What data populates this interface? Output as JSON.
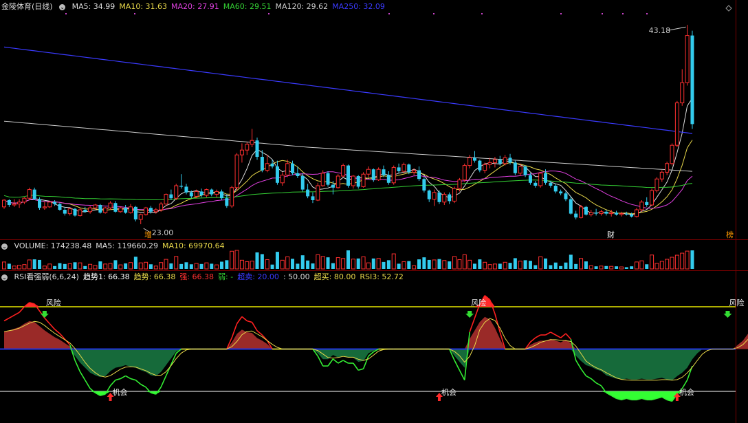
{
  "price_panel": {
    "title": "金陵体育(日线)",
    "ma_items": [
      {
        "label": "MA5: 34.99",
        "color": "#dddddd"
      },
      {
        "label": "MA10: 31.63",
        "color": "#e8d84a"
      },
      {
        "label": "MA20: 27.91",
        "color": "#e040e0"
      },
      {
        "label": "MA60: 29.51",
        "color": "#34d134"
      },
      {
        "label": "MA120: 29.62",
        "color": "#cccccc"
      },
      {
        "label": "MA250: 32.09",
        "color": "#3a3aff"
      }
    ],
    "high_label": "43.18",
    "low_label": "23.00",
    "markers": [
      {
        "text": "增",
        "color": "#ff9900"
      },
      {
        "text": "财",
        "color": "#ffffff"
      },
      {
        "text": "榜",
        "color": "#ff9900"
      }
    ]
  },
  "volume_panel": {
    "items": [
      {
        "label": "VOLUME: 174238.48",
        "color": "#dddddd"
      },
      {
        "label": "MA5: 119660.29",
        "color": "#dddddd"
      },
      {
        "label": "MA10: 69970.64",
        "color": "#e8d84a"
      }
    ]
  },
  "rsi_panel": {
    "items": [
      {
        "label": "RSI看强弱(6,6,24)",
        "color": "#dddddd"
      },
      {
        "label": "趋势1: 66.38",
        "color": "#ffffff"
      },
      {
        "label": "趋势: 66.38",
        "color": "#e8d84a"
      },
      {
        "label": "强: 66.38",
        "color": "#ff3030"
      },
      {
        "label": "弱: -",
        "color": "#34d134"
      },
      {
        "label": "超卖: 20.00",
        "color": "#3a3aff"
      },
      {
        "label": ": 50.00",
        "color": "#dddddd"
      },
      {
        "label": "超买: 80.00",
        "color": "#e8d84a"
      },
      {
        "label": "RSI3: 52.72",
        "color": "#e8d84a"
      }
    ],
    "signals": [
      {
        "text": "风险",
        "kind": "risk"
      },
      {
        "text": "风险",
        "kind": "risk"
      },
      {
        "text": "风险",
        "kind": "risk"
      },
      {
        "text": "机会",
        "kind": "chance"
      },
      {
        "text": "机会",
        "kind": "chance"
      },
      {
        "text": "机会",
        "kind": "chance"
      }
    ]
  },
  "chart_data": {
    "type": "candlestick",
    "title": "金陵体育(日线)",
    "ylim": [
      21.5,
      44.5
    ],
    "candles": [
      [
        24.3,
        25.1,
        24.1,
        25.0
      ],
      [
        25.0,
        25.1,
        24.3,
        24.5
      ],
      [
        24.5,
        25.1,
        24.3,
        24.6
      ],
      [
        24.6,
        25.1,
        24.2,
        24.8
      ],
      [
        24.8,
        25.3,
        24.6,
        25.2
      ],
      [
        25.2,
        26.3,
        25.0,
        26.1
      ],
      [
        26.1,
        26.3,
        25.0,
        25.1
      ],
      [
        25.1,
        25.3,
        24.0,
        24.2
      ],
      [
        24.2,
        24.8,
        24.0,
        24.3
      ],
      [
        24.3,
        24.9,
        24.2,
        24.8
      ],
      [
        24.8,
        25.0,
        24.4,
        24.6
      ],
      [
        24.6,
        24.7,
        23.9,
        24.0
      ],
      [
        24.0,
        24.3,
        23.4,
        23.6
      ],
      [
        23.6,
        24.2,
        23.4,
        24.1
      ],
      [
        24.1,
        24.2,
        23.3,
        23.4
      ],
      [
        23.4,
        24.2,
        23.3,
        24.0
      ],
      [
        24.0,
        24.3,
        23.7,
        23.8
      ],
      [
        23.8,
        24.4,
        23.6,
        24.2
      ],
      [
        24.2,
        24.6,
        24.0,
        24.5
      ],
      [
        24.5,
        24.6,
        23.6,
        23.7
      ],
      [
        23.7,
        24.3,
        23.6,
        24.2
      ],
      [
        24.2,
        24.9,
        24.0,
        24.7
      ],
      [
        24.7,
        24.9,
        23.7,
        23.8
      ],
      [
        23.8,
        24.3,
        23.7,
        24.2
      ],
      [
        24.2,
        24.5,
        23.6,
        23.7
      ],
      [
        23.7,
        24.6,
        23.6,
        24.3
      ],
      [
        24.3,
        24.4,
        22.8,
        23.0
      ],
      [
        23.0,
        23.6,
        22.5,
        23.5
      ],
      [
        23.5,
        24.3,
        23.4,
        24.2
      ],
      [
        24.2,
        24.4,
        23.6,
        23.8
      ],
      [
        23.8,
        24.2,
        23.6,
        24.0
      ],
      [
        24.0,
        24.8,
        23.8,
        24.6
      ],
      [
        24.6,
        25.7,
        24.4,
        25.6
      ],
      [
        25.6,
        26.1,
        25.0,
        25.2
      ],
      [
        25.2,
        26.7,
        25.0,
        26.5
      ],
      [
        26.5,
        27.7,
        26.2,
        26.4
      ],
      [
        26.4,
        26.7,
        25.6,
        25.8
      ],
      [
        25.8,
        26.0,
        25.2,
        25.4
      ],
      [
        25.4,
        26.1,
        25.2,
        25.9
      ],
      [
        25.9,
        26.2,
        25.3,
        25.5
      ],
      [
        25.5,
        26.2,
        25.3,
        26.1
      ],
      [
        26.1,
        26.2,
        25.4,
        25.6
      ],
      [
        25.6,
        26.1,
        25.3,
        25.9
      ],
      [
        25.9,
        26.1,
        25.0,
        25.2
      ],
      [
        25.2,
        25.6,
        24.2,
        24.4
      ],
      [
        24.4,
        26.5,
        24.2,
        26.3
      ],
      [
        26.3,
        29.9,
        26.0,
        29.7
      ],
      [
        29.7,
        30.9,
        28.9,
        30.2
      ],
      [
        30.2,
        31.0,
        29.7,
        30.8
      ],
      [
        30.8,
        32.4,
        30.5,
        31.2
      ],
      [
        31.2,
        31.5,
        29.2,
        29.5
      ],
      [
        29.5,
        30.2,
        27.9,
        28.1
      ],
      [
        28.1,
        29.7,
        27.9,
        28.8
      ],
      [
        28.8,
        29.2,
        28.3,
        28.5
      ],
      [
        28.5,
        29.1,
        26.6,
        26.8
      ],
      [
        26.8,
        27.9,
        26.5,
        27.6
      ],
      [
        27.6,
        29.2,
        27.4,
        28.8
      ],
      [
        28.8,
        29.1,
        27.6,
        27.8
      ],
      [
        27.8,
        28.5,
        27.3,
        27.5
      ],
      [
        27.5,
        27.8,
        25.9,
        26.1
      ],
      [
        26.1,
        26.7,
        25.2,
        25.4
      ],
      [
        25.4,
        25.8,
        24.7,
        25.0
      ],
      [
        25.0,
        26.8,
        24.9,
        26.5
      ],
      [
        26.5,
        28.1,
        26.4,
        27.8
      ],
      [
        27.8,
        28.0,
        26.4,
        26.6
      ],
      [
        26.6,
        27.0,
        25.6,
        26.3
      ],
      [
        26.3,
        27.7,
        26.2,
        27.5
      ],
      [
        27.5,
        28.8,
        27.4,
        28.6
      ],
      [
        28.6,
        28.7,
        26.3,
        26.5
      ],
      [
        26.5,
        27.6,
        26.2,
        27.5
      ],
      [
        27.5,
        27.6,
        26.2,
        26.4
      ],
      [
        26.4,
        27.9,
        26.3,
        27.7
      ],
      [
        27.7,
        28.5,
        27.4,
        28.2
      ],
      [
        28.2,
        28.3,
        26.9,
        27.1
      ],
      [
        27.1,
        28.4,
        27.0,
        28.2
      ],
      [
        28.2,
        28.6,
        27.4,
        27.6
      ],
      [
        27.6,
        28.0,
        26.6,
        26.8
      ],
      [
        26.8,
        28.6,
        26.6,
        28.4
      ],
      [
        28.4,
        28.8,
        27.8,
        28.0
      ],
      [
        28.0,
        28.9,
        27.8,
        28.7
      ],
      [
        28.7,
        28.8,
        27.7,
        27.9
      ],
      [
        27.9,
        28.3,
        27.6,
        28.1
      ],
      [
        28.1,
        28.5,
        27.0,
        27.2
      ],
      [
        27.2,
        27.4,
        25.8,
        26.0
      ],
      [
        26.0,
        26.1,
        24.8,
        25.1
      ],
      [
        25.1,
        26.1,
        24.4,
        25.8
      ],
      [
        25.8,
        26.0,
        24.6,
        24.8
      ],
      [
        24.8,
        25.8,
        24.5,
        25.6
      ],
      [
        25.6,
        25.8,
        24.6,
        24.9
      ],
      [
        24.9,
        26.4,
        24.7,
        26.2
      ],
      [
        26.2,
        27.3,
        25.9,
        27.1
      ],
      [
        27.1,
        28.8,
        26.9,
        28.6
      ],
      [
        28.6,
        29.7,
        28.3,
        29.4
      ],
      [
        29.4,
        30.1,
        28.9,
        29.1
      ],
      [
        29.1,
        29.2,
        27.9,
        28.1
      ],
      [
        28.1,
        28.9,
        27.8,
        28.7
      ],
      [
        28.7,
        29.4,
        28.3,
        28.9
      ],
      [
        28.9,
        29.5,
        28.4,
        29.2
      ],
      [
        29.2,
        29.6,
        28.6,
        28.8
      ],
      [
        28.8,
        29.7,
        28.6,
        29.4
      ],
      [
        29.4,
        29.8,
        28.7,
        28.9
      ],
      [
        28.9,
        29.1,
        27.6,
        27.8
      ],
      [
        27.8,
        28.8,
        27.5,
        28.5
      ],
      [
        28.5,
        28.6,
        27.4,
        27.6
      ],
      [
        27.6,
        27.8,
        26.6,
        26.8
      ],
      [
        26.8,
        27.0,
        26.3,
        26.5
      ],
      [
        26.5,
        27.9,
        26.3,
        27.8
      ],
      [
        27.8,
        28.2,
        26.6,
        26.8
      ],
      [
        26.8,
        27.0,
        26.3,
        26.5
      ],
      [
        26.5,
        26.7,
        25.7,
        25.9
      ],
      [
        25.9,
        26.1,
        25.5,
        25.7
      ],
      [
        25.7,
        25.9,
        24.9,
        25.1
      ],
      [
        25.1,
        25.4,
        23.5,
        23.6
      ],
      [
        23.6,
        23.9,
        23.0,
        23.2
      ],
      [
        23.2,
        24.5,
        23.1,
        24.3
      ],
      [
        24.3,
        24.4,
        23.4,
        23.5
      ],
      [
        23.5,
        24.0,
        23.3,
        23.7
      ],
      [
        23.7,
        24.1,
        23.4,
        23.6
      ],
      [
        23.6,
        24.0,
        23.4,
        23.8
      ],
      [
        23.8,
        24.0,
        23.4,
        23.6
      ],
      [
        23.6,
        24.0,
        23.3,
        23.7
      ],
      [
        23.7,
        23.9,
        23.4,
        23.5
      ],
      [
        23.5,
        23.8,
        23.3,
        23.6
      ],
      [
        23.6,
        23.8,
        23.4,
        23.5
      ],
      [
        23.5,
        23.7,
        23.2,
        23.3
      ],
      [
        23.3,
        24.2,
        23.2,
        24.0
      ],
      [
        24.0,
        25.0,
        23.8,
        24.8
      ],
      [
        24.8,
        25.3,
        24.3,
        24.5
      ],
      [
        24.5,
        26.2,
        24.4,
        26.0
      ],
      [
        26.0,
        27.4,
        25.8,
        27.2
      ],
      [
        27.2,
        28.1,
        26.9,
        27.9
      ],
      [
        27.9,
        29.0,
        27.6,
        28.8
      ],
      [
        28.8,
        30.9,
        28.6,
        30.7
      ],
      [
        30.7,
        35.3,
        30.5,
        35.1
      ],
      [
        35.1,
        38.6,
        34.8,
        37.2
      ],
      [
        37.2,
        43.2,
        36.9,
        42.1
      ],
      [
        42.1,
        42.6,
        32.4,
        32.9
      ]
    ],
    "rsi_strong": [
      70,
      72,
      74,
      76,
      80,
      83,
      82,
      77,
      72,
      68,
      64,
      61,
      57,
      53,
      50,
      50,
      50,
      50,
      50,
      50,
      50,
      50,
      50,
      50,
      50,
      50,
      50,
      50,
      50,
      50,
      50,
      50,
      50,
      50,
      50,
      50,
      50,
      50,
      50,
      50,
      50,
      50,
      50,
      50,
      50,
      58,
      68,
      73,
      70,
      69,
      63,
      60,
      56,
      50,
      50,
      50,
      50,
      50,
      50,
      50,
      50,
      50,
      50,
      50,
      50,
      50,
      50,
      50,
      50,
      50,
      50,
      50,
      50,
      50,
      50,
      50,
      50,
      50,
      50,
      50,
      50,
      50,
      50,
      50,
      50,
      50,
      50,
      50,
      50,
      50,
      50,
      50,
      62,
      72,
      82,
      88,
      85,
      75,
      62,
      50,
      50,
      50,
      50,
      50,
      55,
      58,
      60,
      60,
      62,
      60,
      58,
      61,
      57,
      50,
      50,
      50,
      50,
      50,
      50,
      50,
      50,
      50,
      50,
      50,
      50,
      50,
      50,
      50,
      50,
      50,
      50,
      50,
      50,
      50,
      50,
      50,
      50,
      50,
      50,
      50,
      50,
      50,
      50,
      50,
      50,
      55,
      60,
      68,
      78,
      88,
      91,
      89,
      84,
      71,
      61
    ],
    "rsi_weak": [
      50,
      50,
      50,
      50,
      50,
      50,
      50,
      50,
      50,
      50,
      50,
      50,
      50,
      50,
      42,
      34,
      28,
      22,
      19,
      17,
      18,
      24,
      28,
      29,
      31,
      29,
      28,
      25,
      23,
      19,
      18,
      23,
      31,
      39,
      47,
      50,
      50,
      50,
      50,
      50,
      50,
      50,
      50,
      50,
      50,
      50,
      50,
      50,
      50,
      50,
      50,
      50,
      50,
      50,
      50,
      50,
      50,
      50,
      50,
      50,
      50,
      50,
      45,
      38,
      38,
      43,
      40,
      42,
      40,
      40,
      35,
      36,
      45,
      48,
      50,
      50,
      50,
      50,
      50,
      50,
      50,
      50,
      50,
      50,
      50,
      50,
      50,
      50,
      50,
      42,
      35,
      28,
      24,
      20,
      19,
      22,
      30,
      40,
      50,
      50,
      50,
      50,
      50,
      50,
      50,
      50,
      50,
      50,
      50,
      50,
      50,
      50,
      50,
      42,
      36,
      31,
      29,
      26,
      24,
      19,
      17,
      15,
      14,
      15,
      14,
      14,
      15,
      14,
      14,
      15,
      16,
      14,
      13,
      18,
      22,
      28,
      38,
      45,
      50,
      50,
      50,
      50,
      50,
      50,
      50,
      50,
      50,
      50,
      50,
      50,
      50,
      50,
      50,
      50,
      50
    ],
    "volume_bars": 145
  }
}
